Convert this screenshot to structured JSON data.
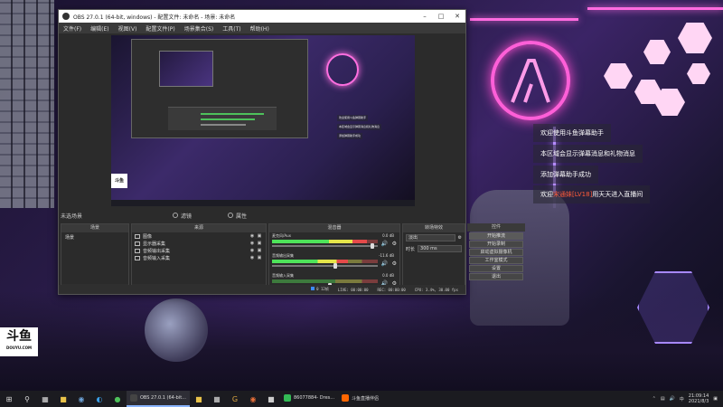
{
  "desktop": {
    "chat": [
      {
        "text": "欢迎使用斗鱼弹幕助手"
      },
      {
        "text": "本区域会显示弹幕消息和礼物消息"
      },
      {
        "text": "添加弹幕助手成功"
      },
      {
        "prefix": "欢迎",
        "highlight": "宋通妹",
        "level": "LV18",
        "suffix": "用天天进入直播间"
      }
    ],
    "logo": {
      "mark": "斗鱼",
      "sub": "DOUYU.COM"
    }
  },
  "obs": {
    "title": "OBS 27.0.1 (64-bit, windows) - 配置文件: 未命名 - 场景: 未命名",
    "menu": [
      "文件(F)",
      "编辑(E)",
      "视图(V)",
      "配置文件(P)",
      "场景集合(S)",
      "工具(T)",
      "帮助(H)"
    ],
    "scene_bar": {
      "label": "未选场景",
      "tab2": "滤镜",
      "tab3": "属性"
    },
    "docks": {
      "scenes": {
        "header": "场景",
        "items": [
          "场景"
        ]
      },
      "sources": {
        "header": "来源",
        "items": [
          {
            "name": "图像",
            "icon": "image-icon"
          },
          {
            "name": "显示器采集",
            "icon": "monitor-icon"
          },
          {
            "name": "音频输出采集",
            "icon": "speaker-icon"
          },
          {
            "name": "音频输入采集",
            "icon": "mic-icon"
          }
        ]
      },
      "mixer": {
        "header": "混音器",
        "tracks": [
          {
            "name": "麦克风/Aux",
            "db": "0.0 dB",
            "level": 0.9,
            "volume": 0.95
          },
          {
            "name": "音频输出采集",
            "db": "-11.6 dB",
            "level": 0.72,
            "volume": 0.6
          },
          {
            "name": "音频输入采集",
            "db": "0.0 dB",
            "level": 0.0,
            "volume": 0.55
          }
        ]
      },
      "transitions": {
        "header": "转场特效",
        "type": "淡出",
        "duration_label": "时长",
        "duration": "300 ms"
      },
      "controls": {
        "header": "控件",
        "buttons": [
          "开始推流",
          "开始录制",
          "启动虚拟摄像机",
          "工作室模式",
          "设置",
          "退出"
        ]
      }
    },
    "status": {
      "live": "LIVE: 00:00:00",
      "rec": "REC: 00:00:00",
      "cpu": "CPU: 3.4%, 30.00 fps",
      "dropped": "0",
      "ms": "12帧"
    }
  },
  "taskbar": {
    "apps": [
      {
        "label": "OBS 27.0.1 (64-bit...",
        "color": "#444"
      },
      {
        "label": "86077884- Dres...",
        "color": "#3b5"
      },
      {
        "label": "斗鱼直播伴侣",
        "color": "#f60"
      }
    ],
    "time": "21:09:14",
    "date": "2021/8/3"
  }
}
